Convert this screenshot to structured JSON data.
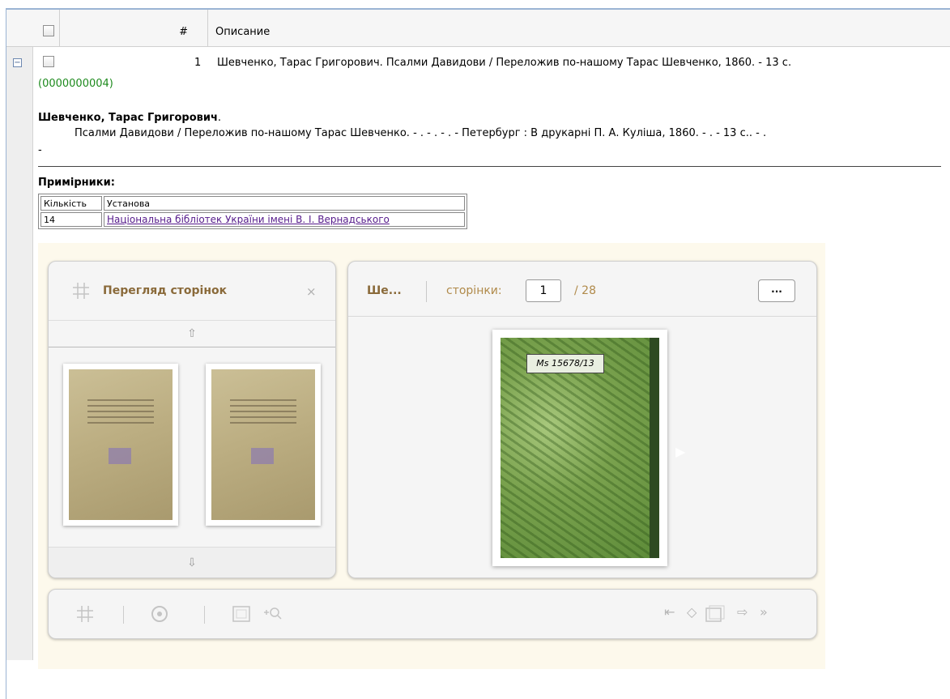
{
  "grid": {
    "header": {
      "num": "#",
      "description": "Описание"
    },
    "row": {
      "number": "1",
      "title": "Шевченко, Тарас Григорович. Псалми Давидови / Переложив по-нашому Тарас Шевченко, 1860. - 13 с.",
      "record_id": "(0000000004)",
      "author": "Шевченко, Тарас Григорович",
      "author_suffix": ".",
      "biblio": "Псалми Давидови / Переложив по-нашому Тарас Шевченко. - . - . - . - Петербург : В друкарні П. А. Куліша, 1860. - . - 13 с.. - .",
      "trailing": "-"
    }
  },
  "copies": {
    "title": "Примірники:",
    "headers": [
      "Кількість",
      "Установа"
    ],
    "rows": [
      {
        "count": "14",
        "institution": "Національна бібліотек України імені В. І. Вернадського"
      }
    ]
  },
  "viewer": {
    "thumbs_panel": {
      "title": "Перегляд сторінок",
      "close": "×",
      "up": "⇧",
      "down": "⇩"
    },
    "page_panel": {
      "title": "Ше...",
      "pages_label": "сторінки:",
      "current_page": "1",
      "total": "/ 28",
      "more": "...",
      "label_text": "Ms 15678/13"
    }
  }
}
